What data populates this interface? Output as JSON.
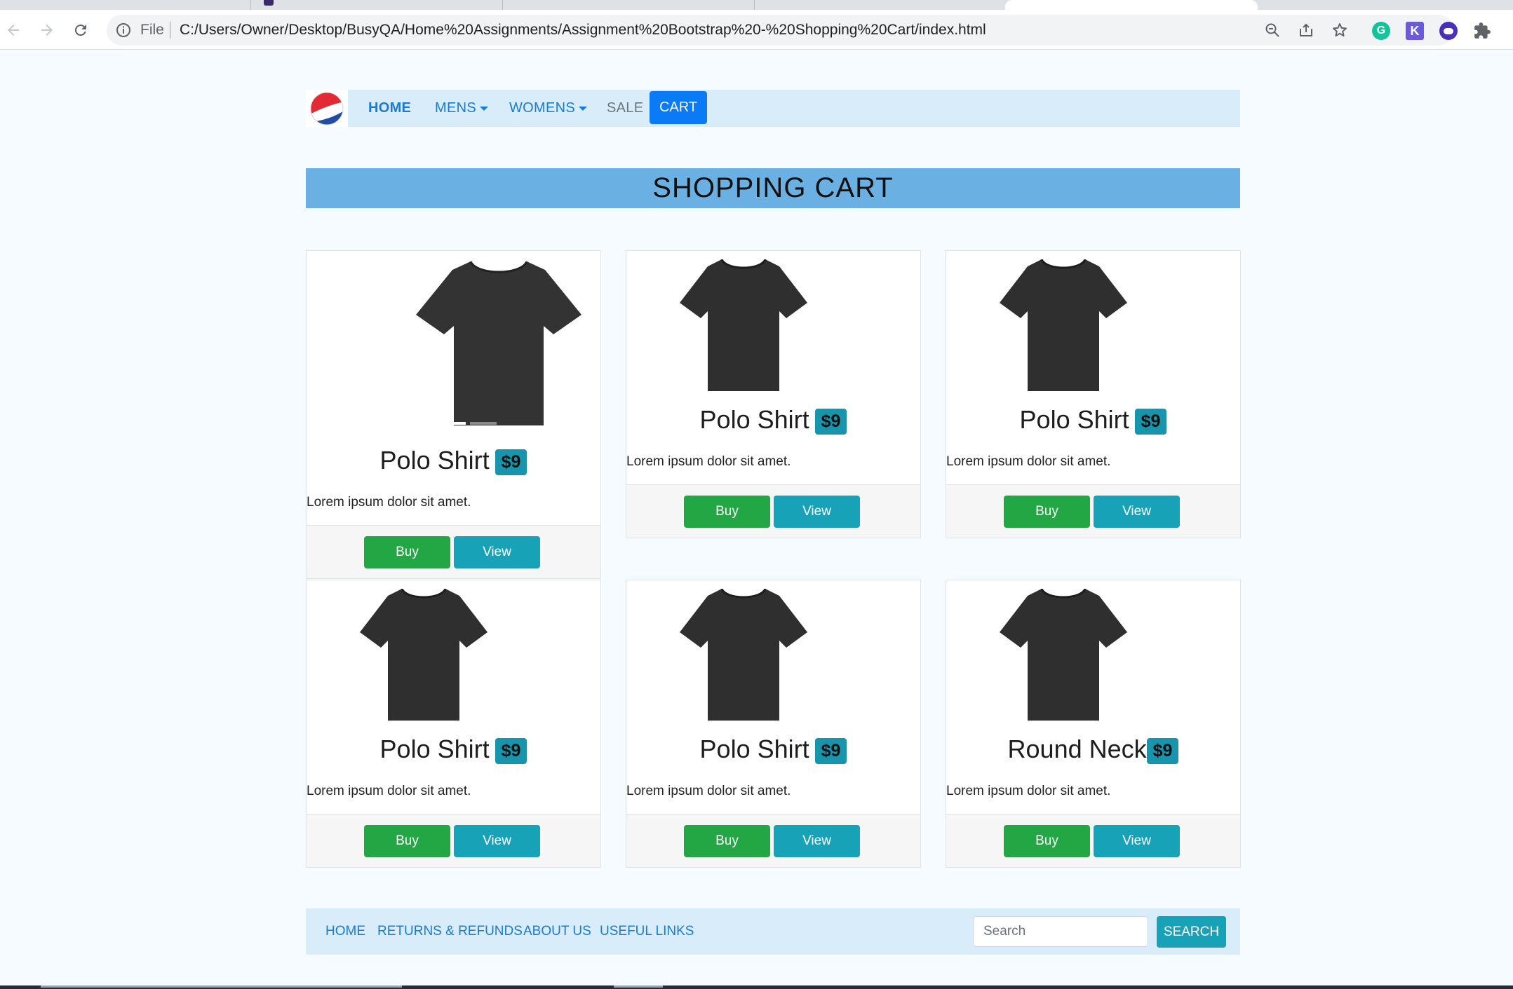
{
  "browser": {
    "scheme_label": "File",
    "url": "C:/Users/Owner/Desktop/BusyQA/Home%20Assignments/Assignment%20Bootstrap%20-%20Shopping%20Cart/index.html"
  },
  "nav": {
    "logo_icon": "pepsi-logo-icon",
    "links": [
      {
        "label": "HOME"
      },
      {
        "label": "MENS"
      },
      {
        "label": "WOMENS"
      },
      {
        "label": "SALE"
      }
    ],
    "cart_label": "CART"
  },
  "header": {
    "title": "SHOPPING CART"
  },
  "products": [
    {
      "name": "Polo Shirt",
      "price": "$9",
      "description": "Lorem ipsum dolor sit amet.",
      "buy_label": "Buy",
      "view_label": "View"
    },
    {
      "name": "Polo Shirt",
      "price": "$9",
      "description": "Lorem ipsum dolor sit amet.",
      "buy_label": "Buy",
      "view_label": "View"
    },
    {
      "name": "Polo Shirt",
      "price": "$9",
      "description": "Lorem ipsum dolor sit amet.",
      "buy_label": "Buy",
      "view_label": "View"
    },
    {
      "name": "Polo Shirt",
      "price": "$9",
      "description": "Lorem ipsum dolor sit amet.",
      "buy_label": "Buy",
      "view_label": "View"
    },
    {
      "name": "Polo Shirt",
      "price": "$9",
      "description": "Lorem ipsum dolor sit amet.",
      "buy_label": "Buy",
      "view_label": "View"
    },
    {
      "name": "Round Neck",
      "price": "$9",
      "description": "Lorem ipsum dolor sit amet.",
      "buy_label": "Buy",
      "view_label": "View"
    }
  ],
  "footer": {
    "links": [
      {
        "label": "HOME"
      },
      {
        "label": "RETURNS & REFUNDS"
      },
      {
        "label": "ABOUT US"
      },
      {
        "label": "USEFUL LINKS"
      }
    ],
    "search_placeholder": "Search",
    "search_button": "SEARCH"
  },
  "colors": {
    "navbar_bg": "#d8edf9",
    "header_bg": "#6bb0e3",
    "cart_button": "#0a7af7",
    "buy_button": "#23a745",
    "view_button": "#17a2b8",
    "price_badge": "#1795ad"
  }
}
